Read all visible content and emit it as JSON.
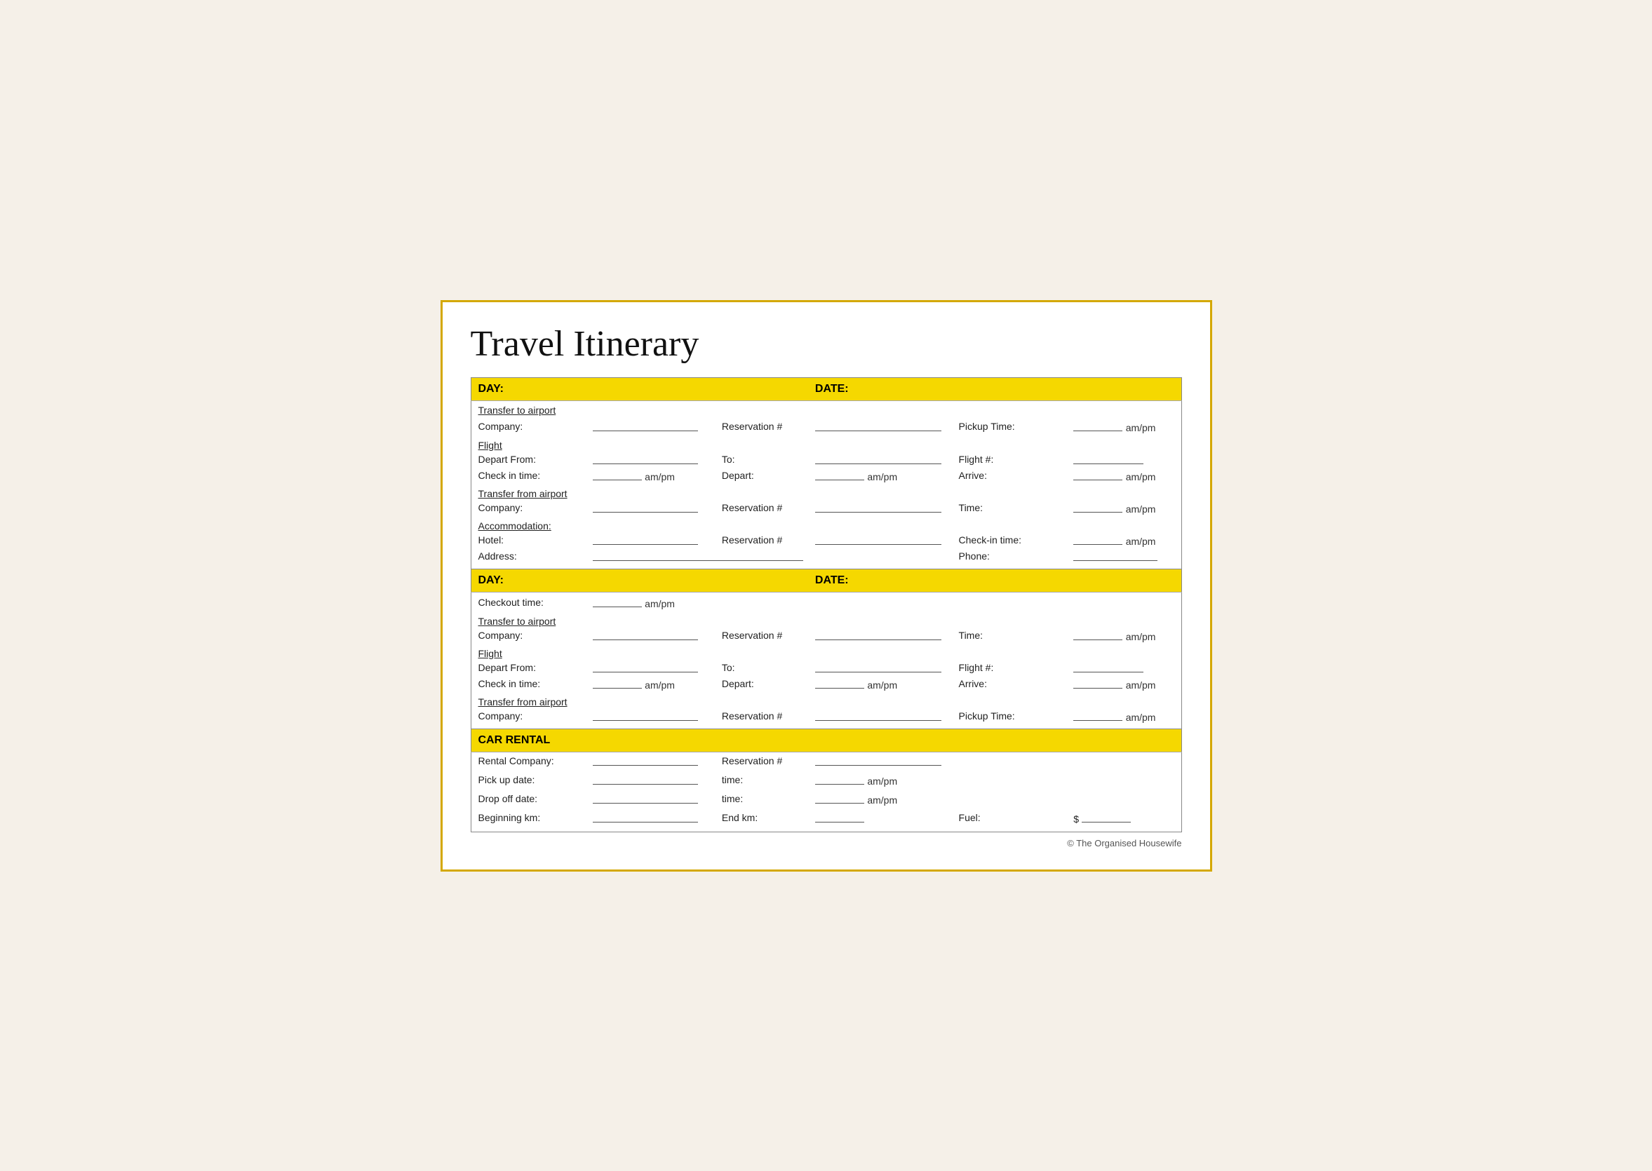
{
  "title": "Travel Itinerary",
  "footer": "© The Organised Housewife",
  "day1": {
    "day_label": "DAY:",
    "date_label": "DATE:",
    "transfer_to_airport": {
      "section": "Transfer to airport",
      "company_label": "Company:",
      "reservation_label": "Reservation #",
      "pickup_time_label": "Pickup Time:",
      "ampm": "am/pm"
    },
    "flight": {
      "section": "Flight",
      "depart_from_label": "Depart From:",
      "to_label": "To:",
      "flight_hash_label": "Flight #:",
      "checkin_label": "Check in time:",
      "depart_label": "Depart:",
      "arrive_label": "Arrive:",
      "ampm": "am/pm"
    },
    "transfer_from_airport": {
      "section": "Transfer from airport",
      "company_label": "Company:",
      "reservation_label": "Reservation #",
      "time_label": "Time:",
      "ampm": "am/pm"
    },
    "accommodation": {
      "section": "Accommodation:",
      "hotel_label": "Hotel:",
      "reservation_label": "Reservation #",
      "checkin_time_label": "Check-in time:",
      "address_label": "Address:",
      "phone_label": "Phone:",
      "ampm": "am/pm"
    }
  },
  "day2": {
    "day_label": "DAY:",
    "date_label": "DATE:",
    "checkout": {
      "label": "Checkout time:",
      "ampm": "am/pm"
    },
    "transfer_to_airport": {
      "section": "Transfer to airport",
      "company_label": "Company:",
      "reservation_label": "Reservation #",
      "time_label": "Time:",
      "ampm": "am/pm"
    },
    "flight": {
      "section": "Flight",
      "depart_from_label": "Depart From:",
      "to_label": "To:",
      "flight_hash_label": "Flight #:",
      "checkin_label": "Check in time:",
      "depart_label": "Depart:",
      "arrive_label": "Arrive:",
      "ampm": "am/pm"
    },
    "transfer_from_airport": {
      "section": "Transfer from airport",
      "company_label": "Company:",
      "reservation_label": "Reservation #",
      "pickup_time_label": "Pickup Time:",
      "ampm": "am/pm"
    }
  },
  "car_rental": {
    "section": "CAR RENTAL",
    "rental_company_label": "Rental Company:",
    "reservation_label": "Reservation #",
    "pickup_date_label": "Pick up date:",
    "time_label": "time:",
    "dropoff_date_label": "Drop off date:",
    "time2_label": "time:",
    "beginning_km_label": "Beginning km:",
    "end_km_label": "End km:",
    "fuel_label": "Fuel:",
    "dollar": "$",
    "ampm": "am/pm"
  }
}
